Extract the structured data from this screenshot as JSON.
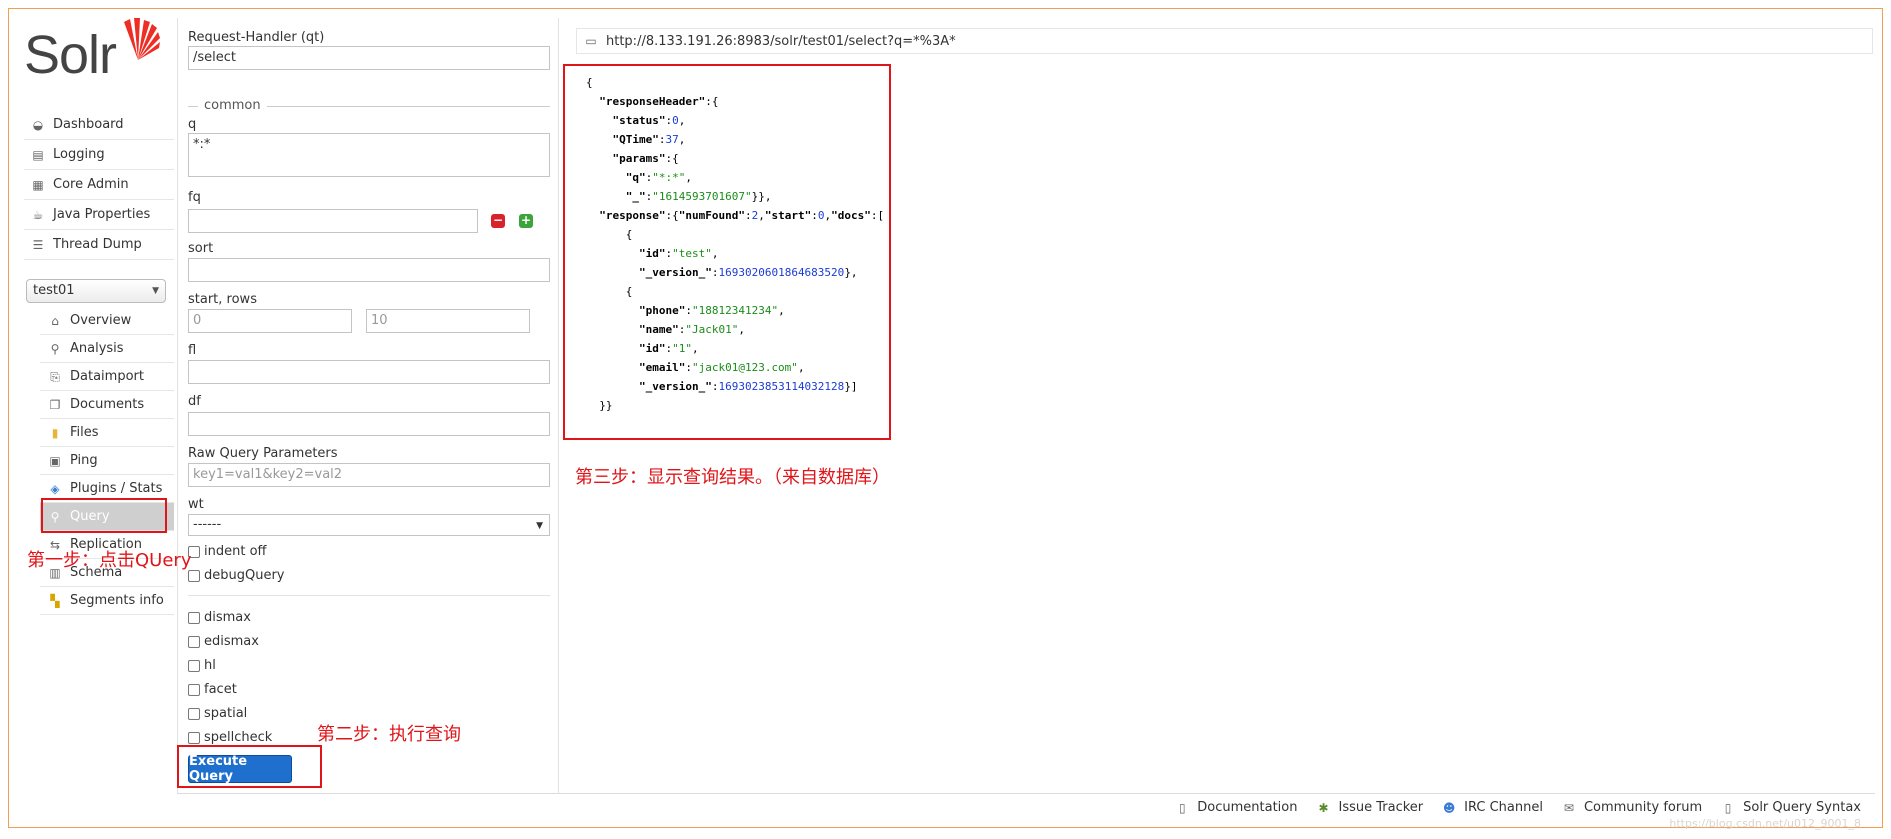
{
  "brand": {
    "name": "Solr",
    "accent": "#e0151a",
    "logo_color": "#ee2d24"
  },
  "nav": {
    "main": [
      {
        "label": "Dashboard",
        "icon": "dashboard-icon"
      },
      {
        "label": "Logging",
        "icon": "logging-icon"
      },
      {
        "label": "Core Admin",
        "icon": "core-admin-icon"
      },
      {
        "label": "Java Properties",
        "icon": "java-properties-icon"
      },
      {
        "label": "Thread Dump",
        "icon": "thread-dump-icon"
      }
    ],
    "core_selector": {
      "value": "test01"
    },
    "core": [
      {
        "label": "Overview",
        "icon": "overview-icon"
      },
      {
        "label": "Analysis",
        "icon": "analysis-icon"
      },
      {
        "label": "Dataimport",
        "icon": "dataimport-icon"
      },
      {
        "label": "Documents",
        "icon": "documents-icon"
      },
      {
        "label": "Files",
        "icon": "files-icon"
      },
      {
        "label": "Ping",
        "icon": "ping-icon"
      },
      {
        "label": "Plugins / Stats",
        "icon": "plugins-icon"
      },
      {
        "label": "Query",
        "icon": "query-icon",
        "active": true
      },
      {
        "label": "Replication",
        "icon": "replication-icon"
      },
      {
        "label": "Schema",
        "icon": "schema-icon"
      },
      {
        "label": "Segments info",
        "icon": "segments-icon"
      }
    ]
  },
  "form": {
    "request_handler_label": "Request-Handler (qt)",
    "request_handler_value": "/select",
    "common_legend": "common",
    "q_label": "q",
    "q_value": "*:*",
    "fq_label": "fq",
    "fq_value": "",
    "sort_label": "sort",
    "sort_value": "",
    "start_rows_label": "start, rows",
    "start_placeholder": "0",
    "rows_placeholder": "10",
    "fl_label": "fl",
    "fl_value": "",
    "df_label": "df",
    "df_value": "",
    "raw_label": "Raw Query Parameters",
    "raw_placeholder": "key1=val1&key2=val2",
    "wt_label": "wt",
    "wt_value": "------",
    "indent_label": "indent off",
    "debug_label": "debugQuery",
    "dismax_label": "dismax",
    "edismax_label": "edismax",
    "hl_label": "hl",
    "facet_label": "facet",
    "spatial_label": "spatial",
    "spellcheck_label": "spellcheck",
    "execute_label": "Execute Query"
  },
  "result": {
    "url": "http://8.133.191.26:8983/solr/test01/select?q=*%3A*",
    "json_lines": [
      {
        "parts": [
          [
            "p",
            "{"
          ]
        ]
      },
      {
        "parts": [
          [
            "p",
            "  "
          ],
          [
            "k",
            "\"responseHeader\""
          ],
          [
            "p",
            ":{"
          ]
        ]
      },
      {
        "parts": [
          [
            "p",
            "    "
          ],
          [
            "k",
            "\"status\""
          ],
          [
            "p",
            ":"
          ],
          [
            "n",
            "0"
          ],
          [
            "p",
            ","
          ]
        ]
      },
      {
        "parts": [
          [
            "p",
            "    "
          ],
          [
            "k",
            "\"QTime\""
          ],
          [
            "p",
            ":"
          ],
          [
            "n",
            "37"
          ],
          [
            "p",
            ","
          ]
        ]
      },
      {
        "parts": [
          [
            "p",
            "    "
          ],
          [
            "k",
            "\"params\""
          ],
          [
            "p",
            ":{"
          ]
        ]
      },
      {
        "parts": [
          [
            "p",
            "      "
          ],
          [
            "k",
            "\"q\""
          ],
          [
            "p",
            ":"
          ],
          [
            "s",
            "\"*:*\""
          ],
          [
            "p",
            ","
          ]
        ]
      },
      {
        "parts": [
          [
            "p",
            "      "
          ],
          [
            "k",
            "\"_\""
          ],
          [
            "p",
            ":"
          ],
          [
            "s",
            "\"1614593701607\""
          ],
          [
            "p",
            "}},"
          ]
        ]
      },
      {
        "parts": [
          [
            "p",
            "  "
          ],
          [
            "k",
            "\"response\""
          ],
          [
            "p",
            ":{"
          ],
          [
            "k",
            "\"numFound\""
          ],
          [
            "p",
            ":"
          ],
          [
            "n",
            "2"
          ],
          [
            "p",
            ","
          ],
          [
            "k",
            "\"start\""
          ],
          [
            "p",
            ":"
          ],
          [
            "n",
            "0"
          ],
          [
            "p",
            ","
          ],
          [
            "k",
            "\"docs\""
          ],
          [
            "p",
            ":["
          ]
        ]
      },
      {
        "parts": [
          [
            "p",
            "      {"
          ]
        ]
      },
      {
        "parts": [
          [
            "p",
            "        "
          ],
          [
            "k",
            "\"id\""
          ],
          [
            "p",
            ":"
          ],
          [
            "s",
            "\"test\""
          ],
          [
            "p",
            ","
          ]
        ]
      },
      {
        "parts": [
          [
            "p",
            "        "
          ],
          [
            "k",
            "\"_version_\""
          ],
          [
            "p",
            ":"
          ],
          [
            "n",
            "1693020601864683520"
          ],
          [
            "p",
            "},"
          ]
        ]
      },
      {
        "parts": [
          [
            "p",
            "      {"
          ]
        ]
      },
      {
        "parts": [
          [
            "p",
            "        "
          ],
          [
            "k",
            "\"phone\""
          ],
          [
            "p",
            ":"
          ],
          [
            "s",
            "\"18812341234\""
          ],
          [
            "p",
            ","
          ]
        ]
      },
      {
        "parts": [
          [
            "p",
            "        "
          ],
          [
            "k",
            "\"name\""
          ],
          [
            "p",
            ":"
          ],
          [
            "s",
            "\"Jack01\""
          ],
          [
            "p",
            ","
          ]
        ]
      },
      {
        "parts": [
          [
            "p",
            "        "
          ],
          [
            "k",
            "\"id\""
          ],
          [
            "p",
            ":"
          ],
          [
            "s",
            "\"1\""
          ],
          [
            "p",
            ","
          ]
        ]
      },
      {
        "parts": [
          [
            "p",
            "        "
          ],
          [
            "k",
            "\"email\""
          ],
          [
            "p",
            ":"
          ],
          [
            "s",
            "\"jack01@123.com\""
          ],
          [
            "p",
            ","
          ]
        ]
      },
      {
        "parts": [
          [
            "p",
            "        "
          ],
          [
            "k",
            "\"_version_\""
          ],
          [
            "p",
            ":"
          ],
          [
            "n",
            "1693023853114032128"
          ],
          [
            "p",
            "}]"
          ]
        ]
      },
      {
        "parts": [
          [
            "p",
            "  }}"
          ]
        ]
      }
    ]
  },
  "annotations": {
    "step1": "第一步：点击QUery",
    "step2": "第二步：执行查询",
    "step3": "第三步：显示查询结果。（来自数据库）"
  },
  "footer": {
    "links": [
      {
        "label": "Documentation",
        "icon": "documentation-icon"
      },
      {
        "label": "Issue Tracker",
        "icon": "bug-icon"
      },
      {
        "label": "IRC Channel",
        "icon": "irc-icon"
      },
      {
        "label": "Community forum",
        "icon": "mail-icon"
      },
      {
        "label": "Solr Query Syntax",
        "icon": "syntax-icon"
      }
    ],
    "watermark": "https://blog.csdn.net/u012_9001_8"
  }
}
